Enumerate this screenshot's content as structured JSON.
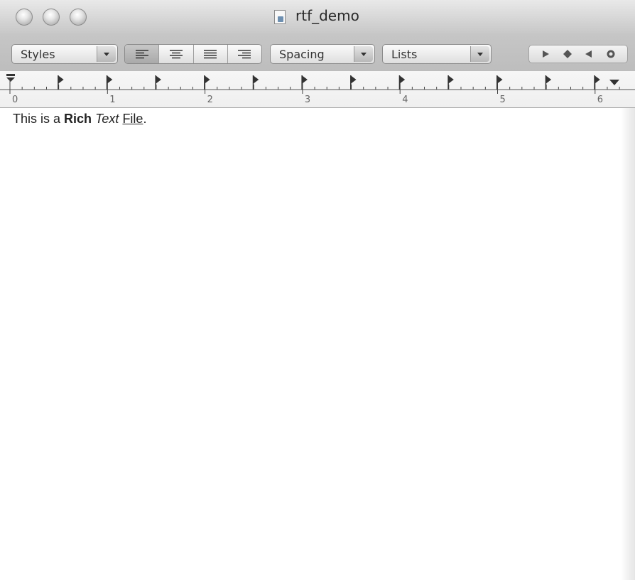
{
  "window": {
    "title": "rtf_demo"
  },
  "toolbar": {
    "styles_label": "Styles",
    "spacing_label": "Spacing",
    "lists_label": "Lists",
    "alignment": [
      "align-left",
      "align-center",
      "align-justify",
      "align-right"
    ],
    "selected_alignment": "align-left",
    "nav_icons": [
      "play-right-icon",
      "diamond-icon",
      "play-left-icon",
      "circle-icon"
    ]
  },
  "ruler": {
    "numbers": [
      "0",
      "1",
      "2",
      "3",
      "4",
      "5",
      "6"
    ]
  },
  "document": {
    "text_plain1": "This is a ",
    "text_bold": "Rich",
    "text_space1": " ",
    "text_italic": "Text",
    "text_space2": " ",
    "text_underline": "File",
    "text_period": "."
  },
  "colors": {
    "titlebar_top": "#e9e9e9",
    "titlebar_bottom": "#c7c7c7",
    "toolbar": "#c3c3c3",
    "ruler": "#f3f3f3",
    "text": "#222222"
  }
}
